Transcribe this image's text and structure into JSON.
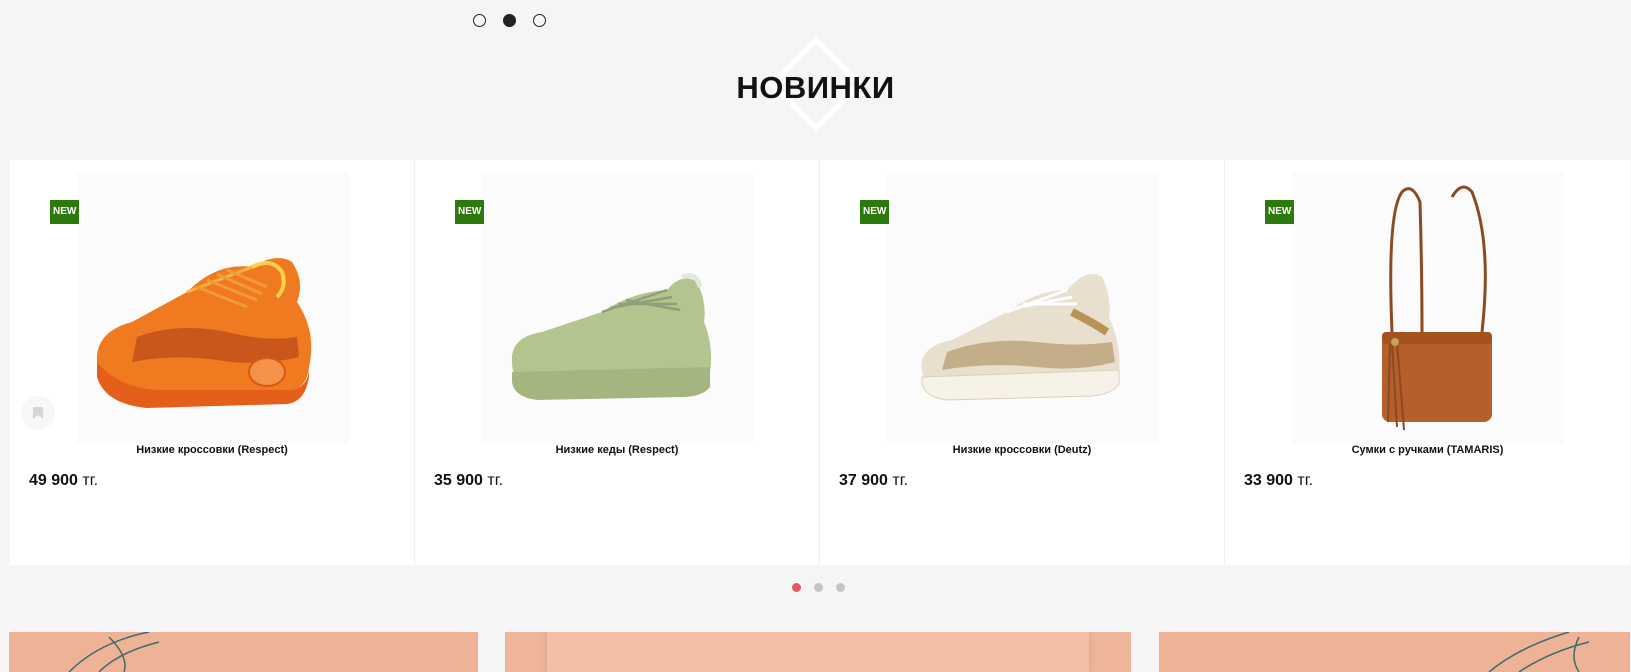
{
  "section": {
    "title": "НОВИНКИ"
  },
  "products": [
    {
      "badge": "NEW",
      "name": "Низкие кроссовки (Respect)",
      "price_amount": "49 900",
      "price_currency": "тг.",
      "image": "orange-sneaker"
    },
    {
      "badge": "NEW",
      "name": "Низкие кеды (Respect)",
      "price_amount": "35 900",
      "price_currency": "тг.",
      "image": "green-sneaker"
    },
    {
      "badge": "NEW",
      "name": "Низкие кроссовки (Deutz)",
      "price_amount": "37 900",
      "price_currency": "тг.",
      "image": "beige-sneaker"
    },
    {
      "badge": "NEW",
      "name": "Сумки с ручками (TAMARIS)",
      "price_amount": "33 900",
      "price_currency": "тг.",
      "image": "brown-crossbody-bag"
    }
  ],
  "colors": {
    "badge": "#2b7a0b",
    "active_dot": "#e85a5a",
    "banner": "#eeb297"
  },
  "top_carousel": {
    "pages": 3,
    "active": 2
  },
  "product_carousel": {
    "pages": 3,
    "active": 1
  }
}
